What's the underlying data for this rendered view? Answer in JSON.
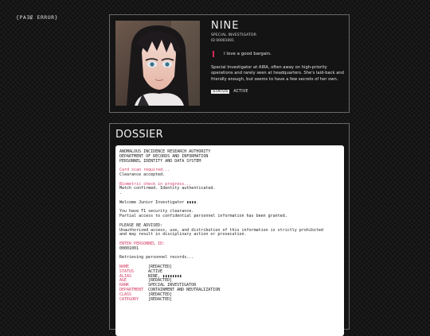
{
  "logo": {
    "text": "{PAƎɆ ERROR}"
  },
  "profile": {
    "name": "NINE",
    "role": "SPECIAL INVESTIGATOR",
    "id": "ID 00001001",
    "quote": "I love a good bargain.",
    "description": "Special Investigator at AIRA, often away on high-priority operations and rarely seen at headquarters. She's laid-back and friendly enough, but seems to have a few secrets of her own.",
    "tag_status": "STATUS",
    "tag_active": "ACTIVE"
  },
  "dossier": {
    "title": "DOSSIER",
    "header_1": "ANOMALOUS INCIDENCE RESEARCH AUTHORITY",
    "header_2": "DEPARTMENT OF RECORDS AND INFORMATION",
    "header_3": "PERSONNEL IDENTITY AND DATA SYSTEM",
    "card_scan": "Card scan required...",
    "clearance_accepted": "Clearance accepted.",
    "biometric": "Biometric check in progress...",
    "match": "Match confirmed. Identity authenticated.",
    "dot": ".",
    "welcome": "Welcome Junior Investigator ▮▮▮▮.",
    "clearance_t1": "You have T1 security clearance.",
    "partial_access": "Partial access to confidential personnel information has been granted.",
    "advised": "PLEASE BE ADVISED:",
    "unauth_1": "Unauthorized access, use, and distribution of this information is strictly prohibited",
    "unauth_2": "and may result in disciplinary action or prosecution.",
    "enter_id": "ENTER PERSONNEL ID:",
    "entered_id": "00001001",
    "retrieving": "Retrieving personnel records...",
    "records": [
      {
        "key": "NAME",
        "value": "[REDACTED]"
      },
      {
        "key": "STATUS",
        "value": "ACTIVE"
      },
      {
        "key": "ALIAS",
        "value": "NINE, ▮▮▮▮▮▮▮▮"
      },
      {
        "key": "AGE",
        "value": "[REDACTED]"
      },
      {
        "key": "RANK",
        "value": "SPECIAL INVESTIGATOR"
      },
      {
        "key": "DEPARTMENT",
        "value": "CONTAINMENT AND NEUTRALIZATION"
      },
      {
        "key": "CLASS",
        "value": "[REDACTED]"
      },
      {
        "key": "CATEGORY",
        "value": "[REDACTED]"
      }
    ]
  }
}
